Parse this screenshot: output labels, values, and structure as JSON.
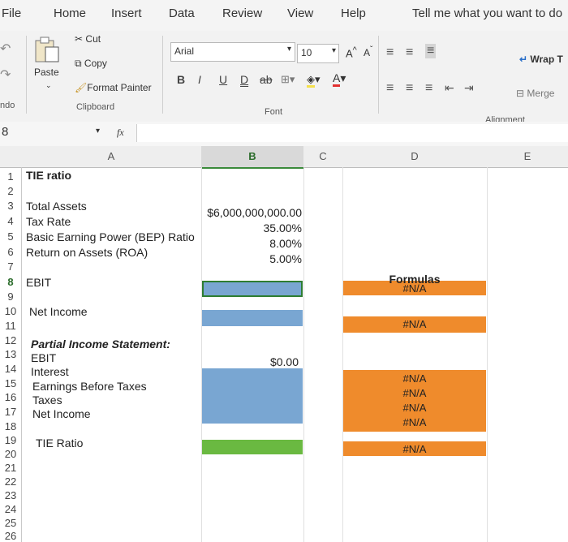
{
  "menu": {
    "file": "File",
    "home": "Home",
    "insert": "Insert",
    "data": "Data",
    "review": "Review",
    "view": "View",
    "help": "Help",
    "tell_me": "Tell me what you want to do"
  },
  "ribbon": {
    "undo_label": "ndo",
    "paste": "Paste",
    "cut": "Cut",
    "copy": "Copy",
    "format_painter": "Format Painter",
    "clipboard_group": "Clipboard",
    "font_name": "Arial",
    "font_size": "10",
    "bold": "B",
    "italic": "I",
    "underline": "U",
    "double_underline": "D",
    "strike": "ab",
    "font_group": "Font",
    "alignment_group": "Alignment",
    "wrap_text": "Wrap T",
    "merge": "Merge"
  },
  "formula_bar": {
    "name_box": "8",
    "fx": "fx",
    "value": ""
  },
  "sheet": {
    "columns": [
      "A",
      "B",
      "C",
      "D",
      "E"
    ],
    "rows": [
      "1",
      "2",
      "3",
      "4",
      "5",
      "6",
      "7",
      "8",
      "9",
      "10",
      "11",
      "12",
      "13",
      "14",
      "15",
      "16",
      "17",
      "18",
      "19",
      "20",
      "21",
      "22",
      "23",
      "24",
      "25",
      "26"
    ],
    "a1": "TIE ratio",
    "a3": "Total Assets",
    "a4": "Tax Rate",
    "a5": "Basic Earning Power (BEP) Ratio",
    "a6": "Return on Assets (ROA)",
    "a8": "EBIT",
    "a10": "Net Income",
    "a12": "Partial Income Statement:",
    "a13": "EBIT",
    "a14": "Interest",
    "a15": "Earnings Before Taxes",
    "a16": "Taxes",
    "a17": "Net Income",
    "a19": "TIE Ratio",
    "b3": "$6,000,000,000.00",
    "b4": "35.00%",
    "b5": "8.00%",
    "b6": "5.00%",
    "b14": "$0.00",
    "d7": "Formulas",
    "d8": "#N/A",
    "d10": "#N/A",
    "d15": "#N/A",
    "d16": "#N/A",
    "d17": "#N/A",
    "d18": "#N/A",
    "d20": "#N/A"
  },
  "colors": {
    "input_blue": "#79a6d2",
    "formula_orange": "#ef8b2c",
    "tie_green": "#6ab941"
  }
}
